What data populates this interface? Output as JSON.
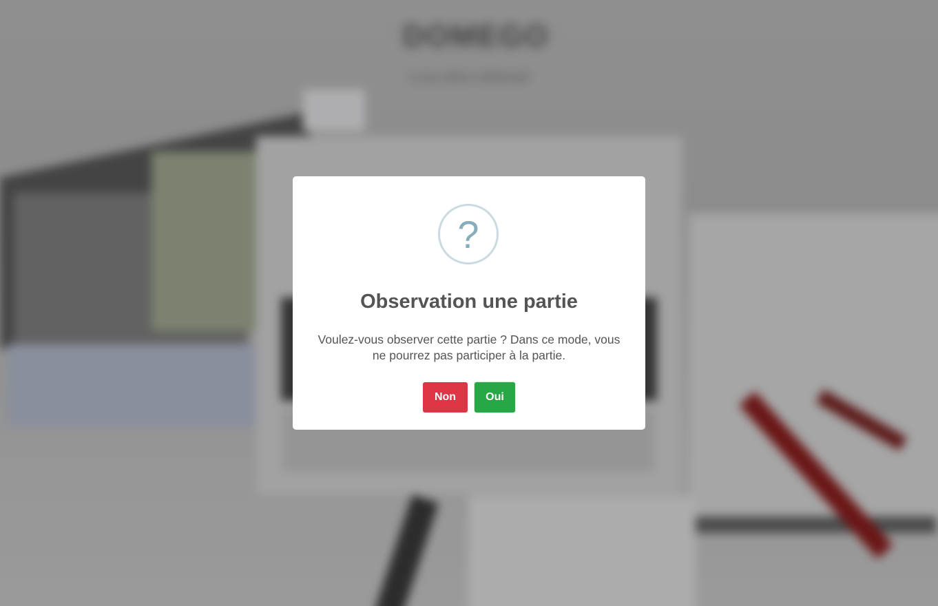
{
  "background": {
    "app_title": "DOMEGO",
    "app_subtitle": "Le jeu ultime collaboratif"
  },
  "dialog": {
    "icon": "question-circle-icon",
    "icon_glyph": "?",
    "title": "Observation une partie",
    "message": "Voulez-vous observer cette partie ? Dans ce mode, vous ne pourrez pas participer à la partie.",
    "cancel_label": "Non",
    "confirm_label": "Oui"
  },
  "colors": {
    "cancel": "#dc3545",
    "confirm": "#28a745",
    "icon": "#87adbd",
    "icon_ring": "#c9dae1",
    "text": "#545454"
  }
}
